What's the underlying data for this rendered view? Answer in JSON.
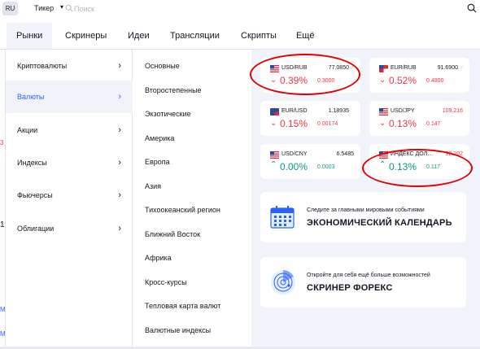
{
  "topbar": {
    "avatar": "RU",
    "ticker_label": "Тикер",
    "search_placeholder": "Поиск"
  },
  "nav": {
    "items": [
      "Рынки",
      "Скринеры",
      "Идеи",
      "Трансляции",
      "Скрипты",
      "Ещё"
    ],
    "active": "Рынки"
  },
  "categories": [
    {
      "label": "Криптовалюты"
    },
    {
      "label": "Валюты"
    },
    {
      "label": "Акции"
    },
    {
      "label": "Индексы"
    },
    {
      "label": "Фьючерсы"
    },
    {
      "label": "Облигации"
    }
  ],
  "subcategories": [
    "Основные",
    "Второстепенные",
    "Экзотические",
    "Америка",
    "Европа",
    "Азия",
    "Тихоокеанский регион",
    "Ближний Восток",
    "Африка",
    "Кросс-курсы",
    "Тепловая карта валют",
    "Валютные индексы"
  ],
  "quotes": [
    {
      "pair": "USD/RUB",
      "price": "77.0850",
      "change_pct": "0.39%",
      "change_abs": "0.3000",
      "direction": "down"
    },
    {
      "pair": "EUR/RUB",
      "price": "91.6900",
      "change_pct": "0.52%",
      "change_abs": "0.4800",
      "direction": "down"
    },
    {
      "pair": "EUR/USD",
      "price": "1.18935",
      "change_pct": "0.15%",
      "change_abs": "0.00174",
      "direction": "down"
    },
    {
      "pair": "USD/JPY",
      "price": "109.216",
      "change_pct": "0.13%",
      "change_abs": "0.147",
      "direction": "down"
    },
    {
      "pair": "USD/CNY",
      "price": "6.5485",
      "change_pct": "0.00%",
      "change_abs": "0.0003",
      "direction": "up"
    },
    {
      "pair": "ИНДЕКС ДОЛ…",
      "price": "92.202",
      "change_pct": "0.13%",
      "change_abs": "0.117",
      "direction": "up"
    }
  ],
  "promos": [
    {
      "subtitle": "Следите за главными мировыми событиями",
      "title": "ЭКОНОМИЧЕСКИЙ КАЛЕНДАРЬ",
      "icon": "calendar-icon"
    },
    {
      "subtitle": "Откройте для себя ещё больше возможностей",
      "title": "СКРИНЕР ФОРЕКС",
      "icon": "radar-icon"
    }
  ],
  "side_marks": [
    "3",
    "1",
    "M",
    "M"
  ],
  "colors": {
    "accent": "#2962ff",
    "negative": "#f23645",
    "positive": "#089981",
    "annotation": "#e00000",
    "panel_bg": "#f0f3fa"
  }
}
